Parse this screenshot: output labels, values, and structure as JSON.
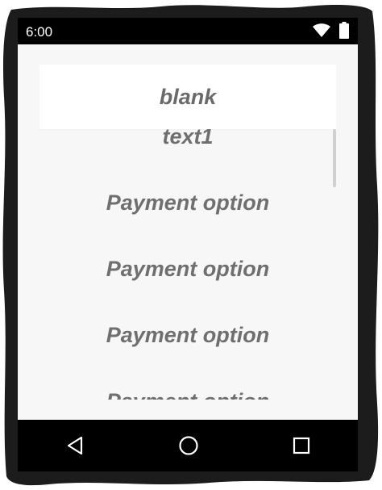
{
  "status_bar": {
    "time": "6:00",
    "wifi_icon": "wifi-icon",
    "battery_icon": "battery-icon"
  },
  "picker": {
    "selected_label": "blank",
    "items": [
      "text1",
      "Payment option",
      "Payment option",
      "Payment option",
      "Payment option"
    ]
  },
  "nav_bar": {
    "back_icon": "back-icon",
    "home_icon": "home-icon",
    "recents_icon": "recents-icon"
  },
  "colors": {
    "status_bar": "#000000",
    "content_background": "#f7f7f7",
    "header_background": "#ffffff",
    "item_text": "#6f6f6f"
  }
}
